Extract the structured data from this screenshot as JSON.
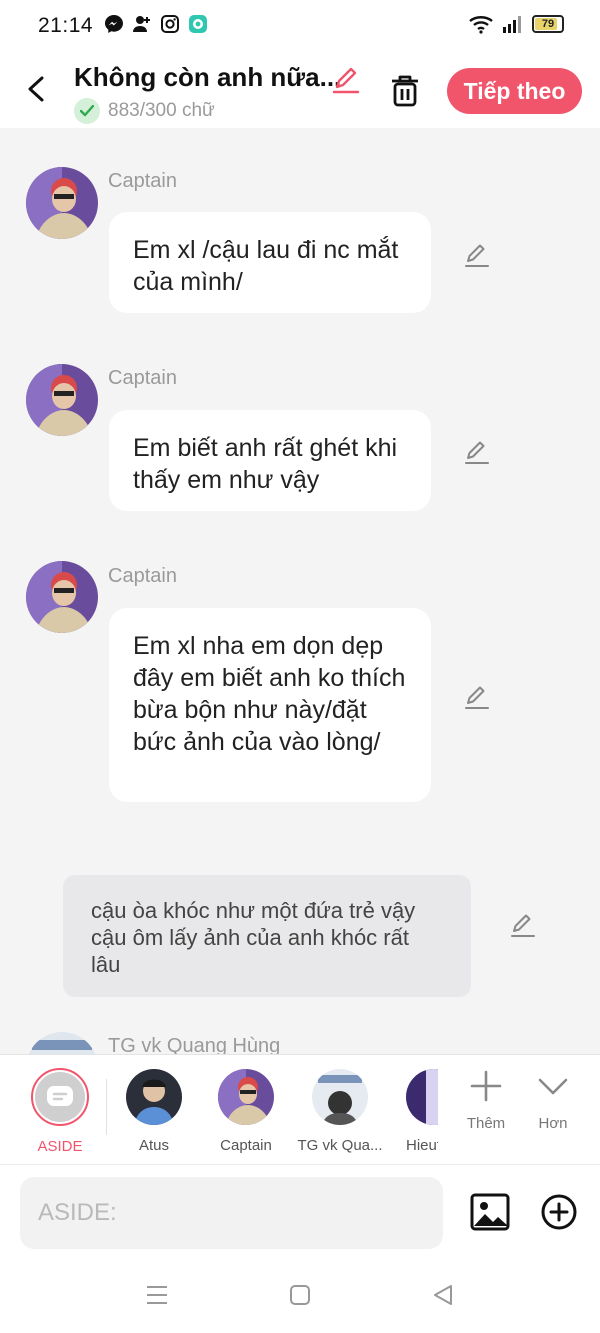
{
  "status_bar": {
    "time": "21:14",
    "battery": "79"
  },
  "header": {
    "title": "Không còn anh nữa...",
    "word_count": "883/300 chữ",
    "next_label": "Tiếp theo"
  },
  "messages": [
    {
      "name": "Captain",
      "text": "Em xl /cậu lau đi nc mắt của mình/"
    },
    {
      "name": "Captain",
      "text": "Em biết anh rất ghét khi thấy em như vậy"
    },
    {
      "name": "Captain",
      "text": "Em xl nha em dọn dẹp đây em biết anh ko thích bừa bộn như này/đặt bức ảnh của vào lòng/"
    }
  ],
  "aside_message": {
    "text": "cậu òa khóc như một đứa trẻ vậy cậu ôm lấy ảnh của anh khóc rất lâu"
  },
  "partial_next_name": "TG vk Quang Hùng",
  "characters": [
    {
      "label": "ASIDE"
    },
    {
      "label": "Atus"
    },
    {
      "label": "Captain"
    },
    {
      "label": "TG vk Qua..."
    },
    {
      "label": "Hieut"
    }
  ],
  "char_actions": {
    "more_label": "Thêm",
    "expand_label": "Hơn"
  },
  "input": {
    "placeholder": "ASIDE:"
  },
  "colors": {
    "accent": "#f1556c",
    "background": "#f4f4f5",
    "bubble": "#ffffff",
    "aside_bubble": "#e8e8ea"
  }
}
